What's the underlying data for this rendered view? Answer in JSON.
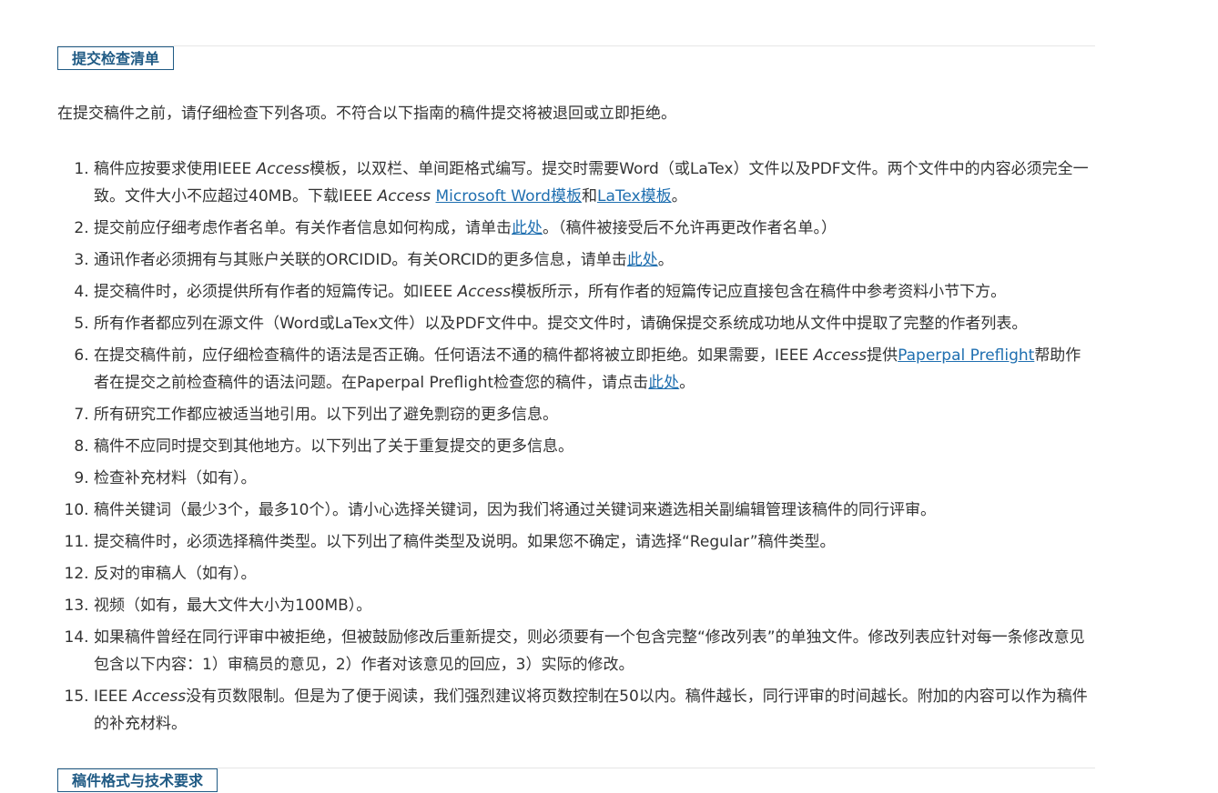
{
  "section_title": "提交检查清单",
  "intro": "在提交稿件之前，请仔细检查下列各项。不符合以下指南的稿件提交将被退回或立即拒绝。",
  "items": [
    {
      "parts": [
        {
          "t": "稿件应按要求使用IEEE "
        },
        {
          "t": "Access",
          "em": true
        },
        {
          "t": "模板，以双栏、单间距格式编写。提交时需要Word（或LaTex）文件以及PDF文件。两个文件中的内容必须完全一致。文件大小不应超过40MB。下载IEEE "
        },
        {
          "t": "Access",
          "em": true
        },
        {
          "t": " "
        },
        {
          "t": "Microsoft Word模板",
          "link": true
        },
        {
          "t": "和"
        },
        {
          "t": "LaTex模板",
          "link": true
        },
        {
          "t": "。"
        }
      ]
    },
    {
      "parts": [
        {
          "t": "提交前应仔细考虑作者名单。有关作者信息如何构成，请单击"
        },
        {
          "t": "此处",
          "link": true
        },
        {
          "t": "。（稿件被接受后不允许再更改作者名单。）"
        }
      ]
    },
    {
      "parts": [
        {
          "t": "通讯作者必须拥有与其账户关联的ORCIDID。有关ORCID的更多信息，请单击"
        },
        {
          "t": "此处",
          "link": true
        },
        {
          "t": "。"
        }
      ]
    },
    {
      "parts": [
        {
          "t": "提交稿件时，必须提供所有作者的短篇传记。如IEEE "
        },
        {
          "t": "Access",
          "em": true
        },
        {
          "t": "模板所示，所有作者的短篇传记应直接包含在稿件中参考资料小节下方。"
        }
      ]
    },
    {
      "parts": [
        {
          "t": "所有作者都应列在源文件（Word或LaTex文件）以及PDF文件中。提交文件时，请确保提交系统成功地从文件中提取了完整的作者列表。"
        }
      ]
    },
    {
      "parts": [
        {
          "t": "在提交稿件前，应仔细检查稿件的语法是否正确。任何语法不通的稿件都将被立即拒绝。如果需要，IEEE "
        },
        {
          "t": "Access",
          "em": true
        },
        {
          "t": "提供"
        },
        {
          "t": "Paperpal Preflight",
          "link": true
        },
        {
          "t": "帮助作者在提交之前检查稿件的语法问题。在Paperpal Preflight检查您的稿件，请点击"
        },
        {
          "t": "此处",
          "link": true
        },
        {
          "t": "。"
        }
      ]
    },
    {
      "parts": [
        {
          "t": "所有研究工作都应被适当地引用。以下列出了避免剽窃的更多信息。"
        }
      ]
    },
    {
      "parts": [
        {
          "t": "稿件不应同时提交到其他地方。以下列出了关于重复提交的更多信息。"
        }
      ]
    },
    {
      "parts": [
        {
          "t": "检查补充材料（如有）。"
        }
      ]
    },
    {
      "parts": [
        {
          "t": "稿件关键词（最少3个，最多10个）。请小心选择关键词，因为我们将通过关键词来遴选相关副编辑管理该稿件的同行评审。"
        }
      ]
    },
    {
      "parts": [
        {
          "t": "提交稿件时，必须选择稿件类型。以下列出了稿件类型及说明。如果您不确定，请选择“Regular”稿件类型。"
        }
      ]
    },
    {
      "parts": [
        {
          "t": "反对的审稿人（如有）。"
        }
      ]
    },
    {
      "parts": [
        {
          "t": "视频（如有，最大文件大小为100MB）。"
        }
      ]
    },
    {
      "parts": [
        {
          "t": "如果稿件曾经在同行评审中被拒绝，但被鼓励修改后重新提交，则必须要有一个包含完整“修改列表”的单独文件。修改列表应针对每一条修改意见包含以下内容：1）审稿员的意见，2）作者对该意见的回应，3）实际的修改。"
        }
      ]
    },
    {
      "parts": [
        {
          "t": "IEEE "
        },
        {
          "t": "Access",
          "em": true
        },
        {
          "t": "没有页数限制。但是为了便于阅读，我们强烈建议将页数控制在50以内。稿件越长，同行评审的时间越长。附加的内容可以作为稿件的补充材料。"
        }
      ]
    }
  ],
  "next_section_title": "稿件格式与技术要求"
}
